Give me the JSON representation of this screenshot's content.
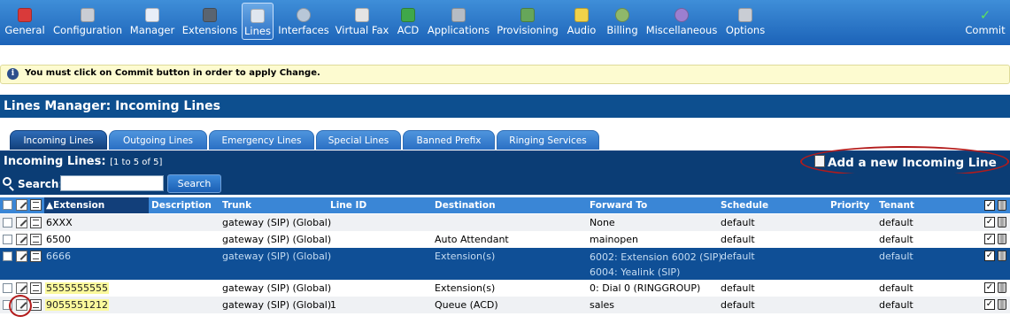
{
  "toolbar": {
    "items": [
      {
        "label": "General",
        "icon": "general-icon"
      },
      {
        "label": "Configuration",
        "icon": "configuration-icon"
      },
      {
        "label": "Manager",
        "icon": "manager-icon"
      },
      {
        "label": "Extensions",
        "icon": "extensions-icon"
      },
      {
        "label": "Lines",
        "icon": "lines-icon",
        "active": true
      },
      {
        "label": "Interfaces",
        "icon": "interfaces-icon"
      },
      {
        "label": "Virtual Fax",
        "icon": "fax-icon"
      },
      {
        "label": "ACD",
        "icon": "acd-icon"
      },
      {
        "label": "Applications",
        "icon": "applications-icon"
      },
      {
        "label": "Provisioning",
        "icon": "provisioning-icon"
      },
      {
        "label": "Audio",
        "icon": "audio-icon"
      },
      {
        "label": "Billing",
        "icon": "billing-icon"
      },
      {
        "label": "Miscellaneous",
        "icon": "miscellaneous-icon"
      },
      {
        "label": "Options",
        "icon": "options-icon"
      }
    ],
    "commit": {
      "label": "Commit",
      "icon": "checkmark-icon"
    }
  },
  "notice": {
    "text": "You must click on Commit button in order to apply Change."
  },
  "page_title": "Lines Manager:  Incoming Lines",
  "tabs": [
    {
      "label": "Incoming Lines",
      "active": true
    },
    {
      "label": "Outgoing Lines"
    },
    {
      "label": "Emergency Lines"
    },
    {
      "label": "Special Lines"
    },
    {
      "label": "Banned Prefix"
    },
    {
      "label": "Ringing Services"
    }
  ],
  "section": {
    "title": "Incoming Lines:",
    "count": "[1 to 5 of 5]",
    "add_label": "Add a new Incoming Line"
  },
  "search": {
    "label": "Search:",
    "value": "",
    "button": "Search"
  },
  "table": {
    "columns": [
      "Extension",
      "Description",
      "Trunk",
      "Line ID",
      "Destination",
      "Forward To",
      "Schedule",
      "Priority",
      "Tenant"
    ],
    "rows": [
      {
        "extension": "6XXX",
        "description": "",
        "trunk": "gateway (SIP) (Global)",
        "line_id": "",
        "destination": "",
        "forward_to": [
          "None"
        ],
        "schedule": "default",
        "priority": "",
        "tenant": "default",
        "enabled": true
      },
      {
        "extension": "6500",
        "description": "",
        "trunk": "gateway (SIP) (Global)",
        "line_id": "",
        "destination": "Auto Attendant",
        "forward_to": [
          "mainopen"
        ],
        "schedule": "default",
        "priority": "",
        "tenant": "default",
        "enabled": true
      },
      {
        "extension": "6666",
        "description": "",
        "trunk": "gateway (SIP) (Global)",
        "line_id": "",
        "destination": "Extension(s)",
        "forward_to": [
          "6002: Extension 6002 (SIP)",
          "6004: Yealink (SIP)"
        ],
        "schedule": "default",
        "priority": "",
        "tenant": "default",
        "enabled": true,
        "selected": true
      },
      {
        "extension": "5555555555",
        "description": "",
        "trunk": "gateway (SIP) (Global)",
        "line_id": "",
        "destination": "Extension(s)",
        "forward_to": [
          "0: Dial 0 (RINGGROUP)"
        ],
        "schedule": "default",
        "priority": "",
        "tenant": "default",
        "enabled": true,
        "highlight": true
      },
      {
        "extension": "9055551212",
        "description": "",
        "trunk": "gateway (SIP) (Global)",
        "line_id": "1",
        "destination": "Queue (ACD)",
        "forward_to": [
          "sales"
        ],
        "schedule": "default",
        "priority": "",
        "tenant": "default",
        "enabled": true,
        "highlight": true
      }
    ]
  },
  "colors": {
    "toolbar": "#2a74c8",
    "header_dark": "#0b3d75",
    "table_header": "#3a86d6",
    "selected_row": "#0f4f96",
    "highlight": "#fbf99c",
    "annotation": "#b31b1b"
  }
}
